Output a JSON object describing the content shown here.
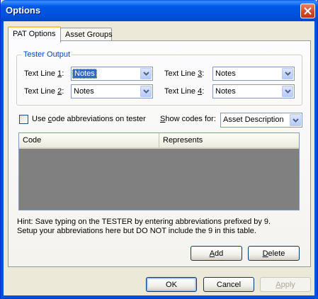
{
  "window": {
    "title": "Options",
    "close_glyph": "✕"
  },
  "tabs": [
    {
      "label": "PAT Options",
      "active": true
    },
    {
      "label": "Asset Groups",
      "active": false
    }
  ],
  "tester_output": {
    "legend": "Tester Output",
    "lines": [
      {
        "label_pre": "Text Line ",
        "label_key": "1",
        "label_post": ":",
        "value": "Notes",
        "selected": true
      },
      {
        "label_pre": "Text Line ",
        "label_key": "2",
        "label_post": ":",
        "value": "Notes",
        "selected": false
      },
      {
        "label_pre": "Text Line ",
        "label_key": "3",
        "label_post": ":",
        "value": "Notes",
        "selected": false
      },
      {
        "label_pre": "Text Line ",
        "label_key": "4",
        "label_post": ":",
        "value": "Notes",
        "selected": false
      }
    ]
  },
  "abbrev": {
    "checkbox_pre": "Use ",
    "checkbox_key": "c",
    "checkbox_post": "ode abbreviations on tester",
    "checked": false
  },
  "show_codes": {
    "label_key": "S",
    "label_post": "how codes for:",
    "value": "Asset Description"
  },
  "table": {
    "columns": [
      "Code",
      "Represents"
    ],
    "rows": []
  },
  "hint": {
    "line1": "Hint: Save typing on the TESTER by entering abbreviations prefixed by 9.",
    "line2": "Setup your abbreviations here but DO NOT include the 9 in this table."
  },
  "buttons": {
    "add": {
      "key": "A",
      "rest": "dd"
    },
    "delete": {
      "key": "D",
      "rest": "elete"
    },
    "ok": "OK",
    "cancel": "Cancel",
    "apply": {
      "key": "A",
      "rest": "pply",
      "disabled": true
    }
  },
  "colors": {
    "title_bar": "#0052de",
    "accent_tab": "#ffc83c",
    "group_legend": "#0046d5",
    "list_background": "#808080"
  }
}
